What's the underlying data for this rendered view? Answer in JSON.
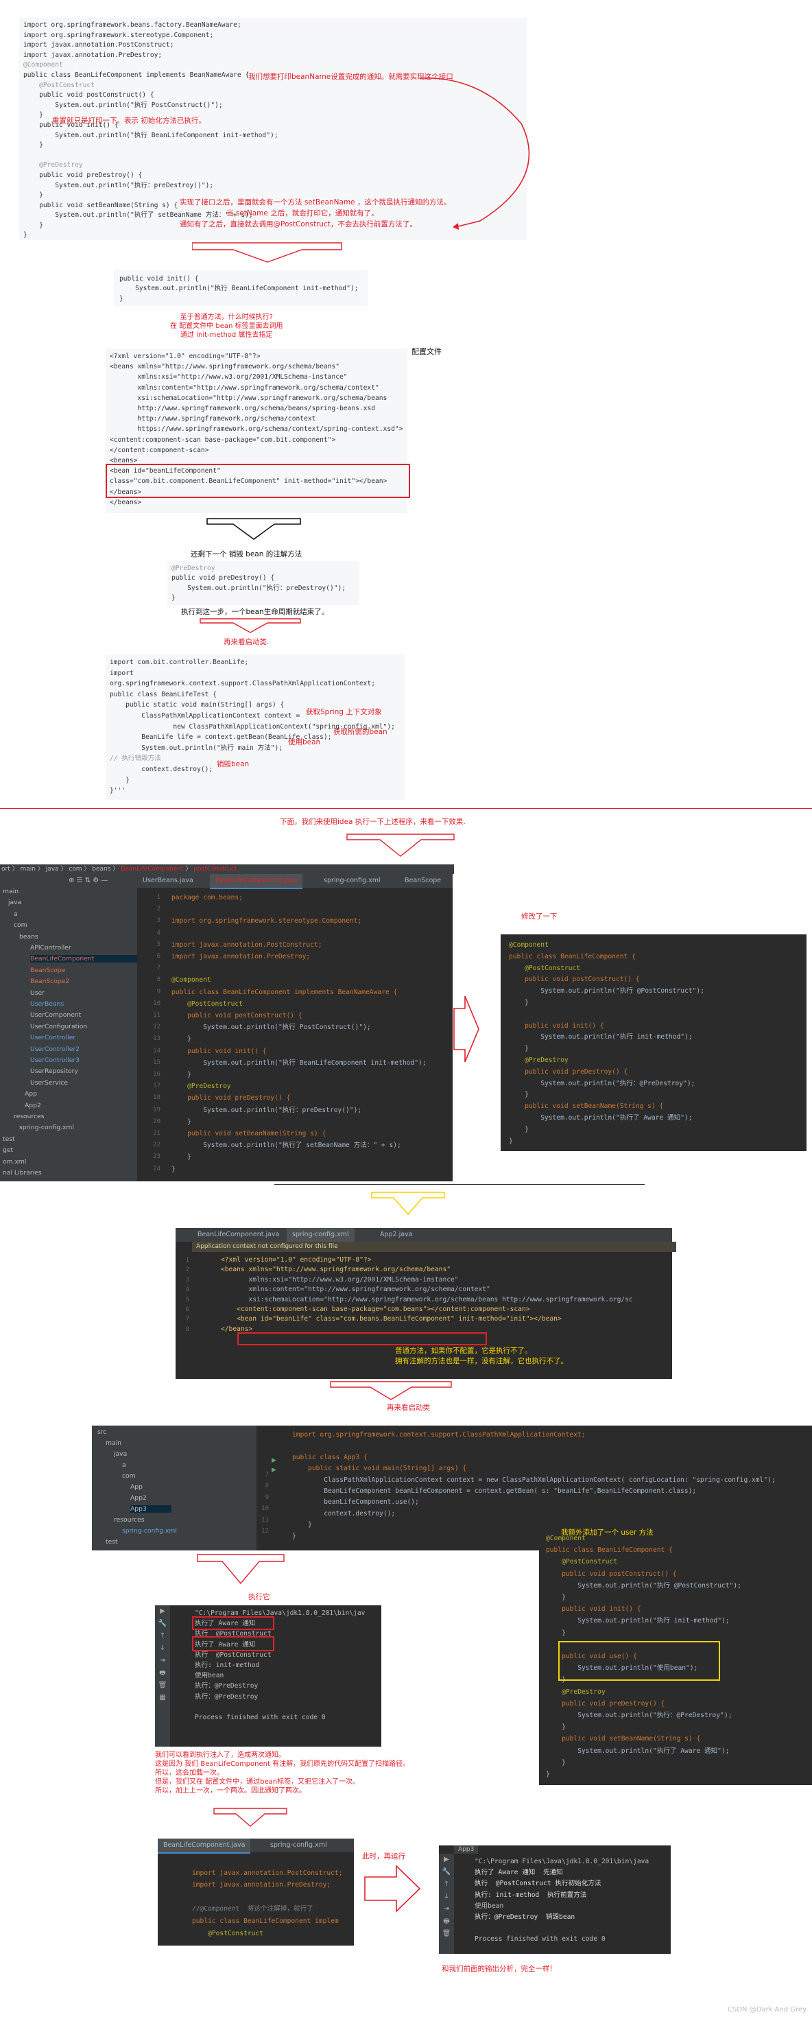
{
  "block1": {
    "lines": [
      "import org.springframework.beans.factory.BeanNameAware;",
      "import org.springframework.stereotype.Component;",
      "import javax.annotation.PostConstruct;",
      "import javax.annotation.PreDestroy;",
      "@Component",
      "public class BeanLifeComponent implements BeanNameAware {",
      "    @PostConstruct",
      "    public void postConstruct() {",
      "        System.out.println(\"执行 PostConstruct()\");",
      "    }",
      "    public void init() {",
      "        System.out.println(\"执行 BeanLifeComponent init-method\");",
      "    }",
      "",
      "    @PreDestroy",
      "    public void preDestroy() {",
      "        System.out.println(\"执行：preDestroy()\");",
      "    }",
      "    public void setBeanName(String s) {",
      "        System.out.println(\"执行了 setBeanName 方法：\" + s);",
      "    }",
      "}"
    ],
    "anno_aware": "我们想要打印beanName设置完成的通知。就需要实现这个接口",
    "anno_postconstruct": "重置就只是打印一下。表示 初始化方法已执行。",
    "anno_setbeanname_1": "实现了接口之后，里面就会有一个方法 setBeanName ，这个就是执行通知的方法。",
    "anno_setbeanname_2": "当 setName 之后，就会打印它，通知就有了。",
    "anno_setbeanname_3": "通知有了之后，直接就去调用@PostConstruct，不会去执行前置方法了。"
  },
  "block2": {
    "lines": [
      "public void init() {",
      "    System.out.println(\"执行 BeanLifeComponent init-method\");",
      "}"
    ],
    "anno": [
      "至于普通方法，什么时候执行?",
      "在 配置文件中 bean 标签里面去调用",
      "通过 init-method 属性去指定"
    ]
  },
  "block3": {
    "title": "配置文件",
    "lines": [
      "<?xml version=\"1.0\" encoding=\"UTF-8\"?>",
      "<beans xmlns=\"http://www.springframework.org/schema/beans\"",
      "       xmlns:xsi=\"http://www.w3.org/2001/XMLSchema-instance\"",
      "       xmlns:content=\"http://www.springframework.org/schema/context\"",
      "       xsi:schemaLocation=\"http://www.springframework.org/schema/beans",
      "       http://www.springframework.org/schema/beans/spring-beans.xsd",
      "       http://www.springframework.org/schema/context",
      "       https://www.springframework.org/schema/context/spring-context.xsd\">",
      "<content:component-scan base-package=\"com.bit.component\">",
      "</content:component-scan>",
      "<beans>",
      "<bean id=\"beanLifeComponent\"",
      "class=\"com.bit.component.BeanLifeComponent\" init-method=\"init\"></bean>",
      "</beans>",
      "</beans>"
    ]
  },
  "block4": {
    "caption_top": "还剩下一个 销毁 bean 的注解方法",
    "lines": [
      "@PreDestroy",
      "public void preDestroy() {",
      "    System.out.println(\"执行：preDestroy()\");",
      "}"
    ],
    "caption_bottom": "执行到这一步，一个bean生命周期就结束了。",
    "restart": "再来看启动类."
  },
  "block5": {
    "lines": [
      "import com.bit.controller.BeanLife;",
      "import",
      "org.springframework.context.support.ClassPathXmlApplicationContext;",
      "public class BeanLifeTest {",
      "    public static void main(String[] args) {",
      "        ClassPathXmlApplicationContext context =",
      "                new ClassPathXmlApplicationContext(\"spring-config.xml\");",
      "        BeanLife life = context.getBean(BeanLife.class);",
      "        System.out.println(\"执行 main 方法\");",
      "// 执行销毁方法",
      "        context.destroy();",
      "    }",
      "}'''"
    ],
    "anno_context": "获取Spring 上下文对象",
    "anno_getbean": "获取所需的bean",
    "anno_use": "使用bean",
    "anno_destroy": "销毁bean"
  },
  "section_caption": "下面，我们来使用idea 执行一下上述程序，来看一下效果.",
  "ide1": {
    "breadcrumb": [
      "ort",
      "main",
      "java",
      "com",
      "beans",
      "BeanLifeComponent",
      "postConstruct"
    ],
    "tabs": [
      "UserBeans.java",
      "BeanLifeComponent.java",
      "spring-config.xml",
      "BeanScope"
    ],
    "tree": [
      "main",
      "java",
      "a",
      "com",
      "beans",
      "APIController",
      "BeanLifeComponent",
      "BeanScope",
      "BeanScope2",
      "User",
      "UserBeans",
      "UserComponent",
      "UserConfiguration",
      "UserController",
      "UserController2",
      "UserController3",
      "UserRepository",
      "UserService",
      "App",
      "App2",
      "resources",
      "spring-config.xml",
      "test",
      "get",
      "om.xml",
      "nal Libraries"
    ],
    "lines": [
      "package com.beans;",
      "",
      "import org.springframework.stereotype.Component;",
      "",
      "import javax.annotation.PostConstruct;",
      "import javax.annotation.PreDestroy;",
      "",
      "@Component",
      "public class BeanLifeComponent implements BeanNameAware {",
      "    @PostConstruct",
      "    public void postConstruct() {",
      "        System.out.println(\"执行 PostConstruct()\");",
      "    }",
      "    public void init() {",
      "        System.out.println(\"执行 BeanLifeComponent init-method\");",
      "    }",
      "    @PreDestroy",
      "    public void preDestroy() {",
      "        System.out.println(\"执行：preDestroy()\");",
      "    }",
      "    public void setBeanName(String s) {",
      "        System.out.println(\"执行了 setBeanName 方法：\" + s);",
      "    }",
      "}"
    ]
  },
  "modified": {
    "title": "修改了一下",
    "lines": [
      "@Component",
      "public class BeanLifeComponent {",
      "    @PostConstruct",
      "    public void postConstruct() {",
      "        System.out.println(\"执行 @PostConstruct\");",
      "    }",
      "",
      "    public void init() {",
      "        System.out.println(\"执行 init-method\");",
      "    }",
      "    @PreDestroy",
      "    public void preDestroy() {",
      "        System.out.println(\"执行：@PreDestroy\");",
      "    }",
      "    public void setBeanName(String s) {",
      "        System.out.println(\"执行了 Aware 通知\");",
      "    }",
      "}"
    ]
  },
  "ide2": {
    "tabs": [
      "BeanLifeComponent.java",
      "spring-config.xml",
      "App2.java"
    ],
    "warning": "Application context not configured for this file",
    "lines": [
      "<?xml version=\"1.0\" encoding=\"UTF-8\"?>",
      "<beans xmlns=\"http://www.springframework.org/schema/beans\"",
      "       xmlns:xsi=\"http://www.w3.org/2001/XMLSchema-instance\"",
      "       xmlns:content=\"http://www.springframework.org/schema/context\"",
      "       xsi:schemaLocation=\"http://www.springframework.org/schema/beans http://www.springframework.org/sc",
      "    <content:component-scan base-package=\"com.beans\"></content:component-scan>",
      "    <bean id=\"beanLife\" class=\"com.beans.BeanLifeComponent\" init-method=\"init\"></bean>",
      "</beans>"
    ],
    "anno": [
      "普通方法，如果你不配置，它是执行不了。",
      "拥有注解的方法也是一样，没有注解，它也执行不了。"
    ],
    "restart": "再来看启动类"
  },
  "ide3": {
    "tree": [
      "src",
      "main",
      "java",
      "a",
      "com",
      "App",
      "App2",
      "App3",
      "resources",
      "spring-config.xml",
      "test"
    ],
    "lines": [
      "import org.springframework.context.support.ClassPathXmlApplicationContext;",
      "",
      "public class App3 {",
      "    public static void main(String[] args) {",
      "        ClassPathXmlApplicationContext context = new ClassPathXmlApplicationContext( configLocation: \"spring-config.xml\");",
      "        BeanLifeComponent beanLifeComponent = context.getBean( s: \"beanLife\",BeanLifeComponent.class);",
      "        beanLifeComponent.use();",
      "        context.destroy();",
      "    }",
      "}"
    ],
    "gutter": [
      "7",
      "8",
      "9",
      "10",
      "11",
      "12"
    ]
  },
  "usecode": {
    "title": "我额外添加了一个 user 方法",
    "lines": [
      "@Component",
      "public class BeanLifeComponent {",
      "    @PostConstruct",
      "    public void postConstruct() {",
      "        System.out.println(\"执行 @PostConstruct\");",
      "    }",
      "    public void init() {",
      "        System.out.println(\"执行 init-method\");",
      "    }",
      "",
      "    public void use() {",
      "        System.out.println(\"使用bean\");",
      "    }",
      "    @PreDestroy",
      "    public void preDestroy() {",
      "        System.out.println(\"执行：@PreDestroy\");",
      "    }",
      "    public void setBeanName(String s) {",
      "        System.out.println(\"执行了 Aware 通知\");",
      "    }",
      "}"
    ]
  },
  "run1": {
    "label": "执行它",
    "lines": [
      "\"C:\\Program Files\\Java\\jdk1.8.0_201\\bin\\jav",
      "执行了 Aware 通知",
      "执行  @PostConstruct",
      "执行了 Aware 通知",
      "执行  @PostConstruct",
      "执行: init-method",
      "使用bean",
      "执行：@PreDestroy",
      "执行：@PreDestroy",
      "",
      "Process finished with exit code 0"
    ],
    "anno": [
      "我们可以看到执行注入了，造成两次通知。",
      "这是因为 我们 BeanLifeComponent 有注解，我们原先的代码又配置了扫描路径。",
      "所以，这会加载一次。",
      "但是，我们又在 配置文件中，通过bean标签，又把它注入了一次。",
      "所以，加上上一次，一个两次。因此通知了两次。"
    ]
  },
  "ide4": {
    "tabs": [
      "BeanLifeComponent.java",
      "spring-config.xml"
    ],
    "lines": [
      "",
      "import javax.annotation.PostConstruct;",
      "import javax.annotation.PreDestroy;",
      "",
      "//@Component  将这个注解掉，就行了",
      "public class BeanLifeComponent implem",
      "    @PostConstruct"
    ],
    "anno": "此时，再运行"
  },
  "run2": {
    "tab": "App3",
    "lines": [
      "\"C:\\Program Files\\Java\\jdk1.8.0_201\\bin\\java",
      "执行了 Aware 通知  先通知",
      "执行  @PostConstruct 执行初始化方法",
      "执行: init-method  执行前置方法",
      "使用bean",
      "执行：@PreDestroy  销毁bean",
      "",
      "Process finished with exit code 0"
    ],
    "anno": "和我们前面的输出分析，完全一样!"
  },
  "watermark": "CSDN @Dark And Grey",
  "colors": {
    "red": "#e0212b",
    "yellow": "#f5d400",
    "ide_bg": "#2b2b2b",
    "code_bg": "#f6f7f9"
  }
}
